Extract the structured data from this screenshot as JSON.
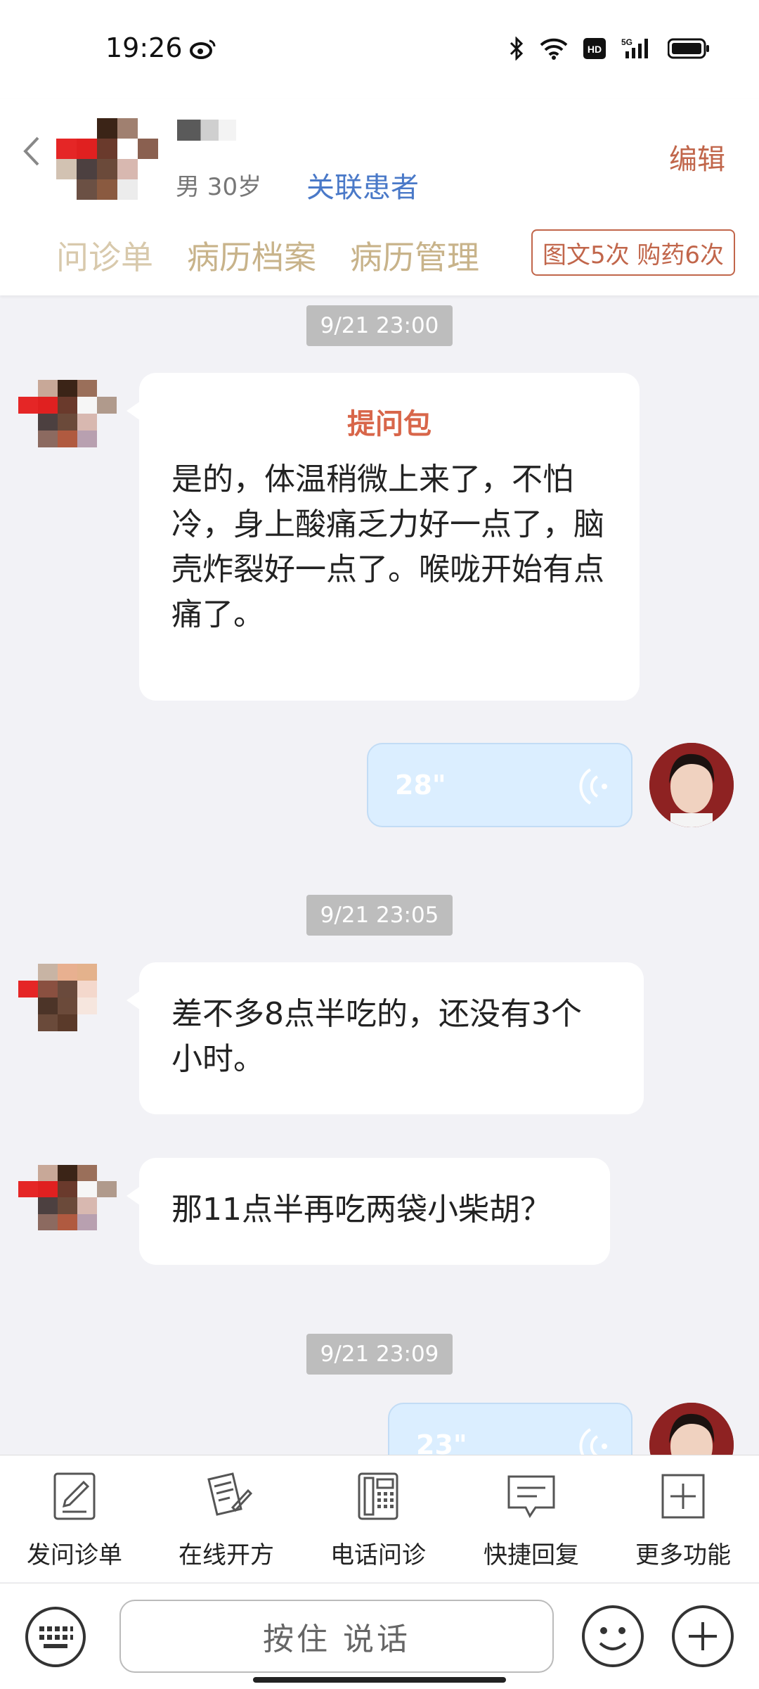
{
  "status_bar": {
    "time": "19:26",
    "icons": [
      "weibo-icon",
      "bluetooth-icon",
      "wifi-icon",
      "hd-icon",
      "5g-signal-icon",
      "battery-icon"
    ]
  },
  "header": {
    "patient_info": "男 30岁",
    "link_patient_label": "关联患者",
    "edit_label": "编辑",
    "tabs": [
      "问诊单",
      "病历档案",
      "病历管理"
    ],
    "quota_label": "图文5次 购药6次"
  },
  "chat": [
    {
      "type": "timestamp",
      "text": "9/21 23:00"
    },
    {
      "type": "patient",
      "title": "提问包",
      "text": "是的，体温稍微上来了，不怕冷，身上酸痛乏力好一点了，脑壳炸裂好一点了。喉咙开始有点痛了。"
    },
    {
      "type": "doctor-voice",
      "duration": "28\""
    },
    {
      "type": "timestamp",
      "text": "9/21 23:05"
    },
    {
      "type": "patient",
      "text": "差不多8点半吃的，还没有3个小时。"
    },
    {
      "type": "patient",
      "text": "那11点半再吃两袋小柴胡？"
    },
    {
      "type": "timestamp",
      "text": "9/21 23:09"
    },
    {
      "type": "doctor-voice",
      "duration": "23\""
    }
  ],
  "toolbar": {
    "items": [
      {
        "label": "发问诊单",
        "icon": "form-icon"
      },
      {
        "label": "在线开方",
        "icon": "prescription-icon"
      },
      {
        "label": "电话问诊",
        "icon": "phone-icon"
      },
      {
        "label": "快捷回复",
        "icon": "quick-reply-icon"
      },
      {
        "label": "更多功能",
        "icon": "more-icon"
      }
    ]
  },
  "input_bar": {
    "hold_to_talk_label": "按住 说话"
  },
  "colors": {
    "accent": "#c1664b",
    "link": "#4a79c8",
    "tab": "#c8b38a",
    "voice_bubble": "#dbeeff"
  }
}
